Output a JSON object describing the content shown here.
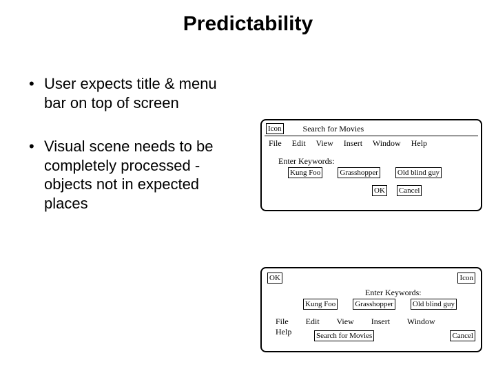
{
  "title": "Predictability",
  "bullets": [
    "User expects title & menu bar on top of screen",
    "Visual scene needs to be completely processed - objects not in expected places"
  ],
  "mock": {
    "icon_label": "Icon",
    "window_title": "Search for Movies",
    "menus": [
      "File",
      "Edit",
      "View",
      "Insert",
      "Window",
      "Help"
    ],
    "keywords_label": "Enter Keywords:",
    "keywords": [
      "Kung Foo",
      "Grasshopper",
      "Old blind guy"
    ],
    "ok": "OK",
    "cancel": "Cancel"
  }
}
